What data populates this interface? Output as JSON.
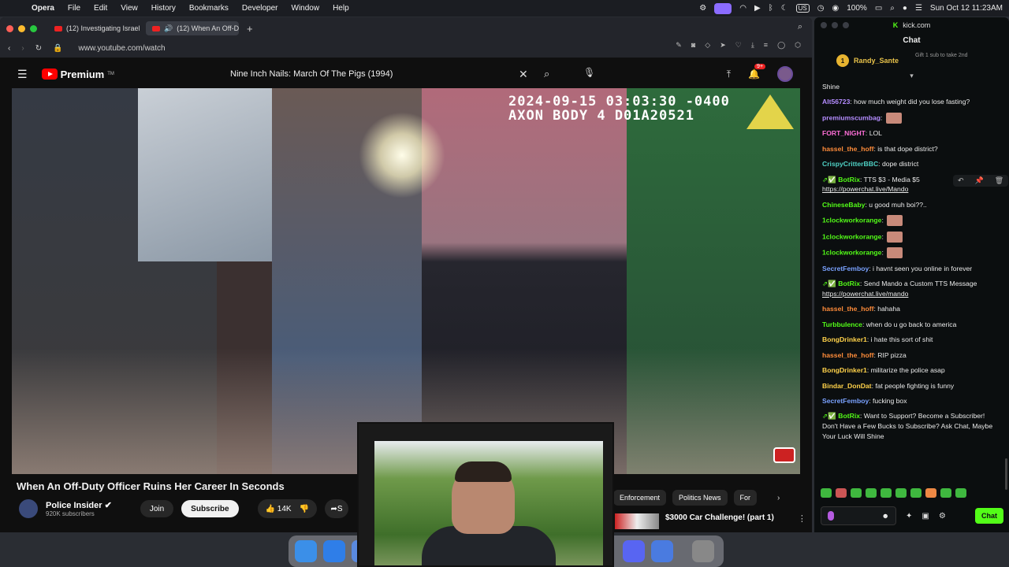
{
  "menubar": {
    "app": "Opera",
    "items": [
      "File",
      "Edit",
      "View",
      "History",
      "Bookmarks",
      "Developer",
      "Window",
      "Help"
    ],
    "battery": "100%",
    "keyboard": "US",
    "datetime": "Sun Oct 12  11:23AM"
  },
  "browser": {
    "tabs": [
      {
        "label": "(12) Investigating Israel"
      },
      {
        "label": "(12) When An Off-D"
      }
    ],
    "url": "www.youtube.com/watch"
  },
  "youtube": {
    "brand": "Premium",
    "brand_tm": "TM",
    "search_query": "Nine Inch Nails: March Of The Pigs (1994)",
    "notification_count": "9+",
    "video": {
      "timestamp_line1": "2024-09-15 03:03:30 -0400",
      "timestamp_line2": "AXON BODY 4 D01A20521"
    },
    "title": "When An Off-Duty Officer Ruins Her Career In Seconds",
    "channel": "Police Insider",
    "subscribers": "920K subscribers",
    "join_label": "Join",
    "subscribe_label": "Subscribe",
    "likes": "14K",
    "share_label": "S",
    "chips": [
      "Enforcement",
      "Politics News",
      "For"
    ],
    "reco_title": "$3000 Car Challenge! (part 1)"
  },
  "chat": {
    "site": "kick.com",
    "header": "Chat",
    "pinned_user": "Randy_Sante",
    "pinned_level": "1",
    "pinned_gift": "Gift 1 sub to take 2nd",
    "messages": [
      {
        "user": "",
        "text": "Shine",
        "color": "#eaeaea"
      },
      {
        "user": "Alt56723",
        "text": "how much weight did you lose fasting?",
        "color": "#b48cff"
      },
      {
        "user": "premiumscumbag",
        "text": "",
        "color": "#b48cff",
        "emote": true
      },
      {
        "user": "FORT_NIGHT",
        "text": "LOL",
        "color": "#ff6fd8"
      },
      {
        "user": "hassel_the_hoff",
        "text": "is that dope district?",
        "color": "#ff8c3a"
      },
      {
        "user": "CrispyCritterBBC",
        "text": "dope district",
        "color": "#4fd1c5"
      },
      {
        "user": "BotRix",
        "text": "TTS $3 - Media $5",
        "link": "https://powerchat.live/Mando",
        "color": "#53fc18",
        "bot": true
      },
      {
        "user": "ChineseBaby",
        "text": "u good muh boi??..",
        "color": "#53fc18"
      },
      {
        "user": "1clockworkorange",
        "text": "",
        "color": "#53fc18",
        "emote": true
      },
      {
        "user": "1clockworkorange",
        "text": "",
        "color": "#53fc18",
        "emote": true
      },
      {
        "user": "1clockworkorange",
        "text": "",
        "color": "#53fc18",
        "emote": true
      },
      {
        "user": "SecretFemboy",
        "text": "i havnt seen you online in forever",
        "color": "#7aa2ff"
      },
      {
        "user": "BotRix",
        "text": "Send Mando a Custom TTS Message",
        "link": "https://powerchat.live/mando",
        "color": "#53fc18",
        "bot": true
      },
      {
        "user": "hassel_the_hoff",
        "text": "hahaha",
        "color": "#ff8c3a"
      },
      {
        "user": "Turbbulence",
        "text": "when do u go back to america",
        "color": "#53fc18"
      },
      {
        "user": "BongDrinker1",
        "text": "i hate this sort of shit",
        "color": "#ffd24a"
      },
      {
        "user": "hassel_the_hoff",
        "text": "RIP pizza",
        "color": "#ff8c3a"
      },
      {
        "user": "BongDrinker1",
        "text": "militarize the police asap",
        "color": "#ffd24a"
      },
      {
        "user": "Bindar_DonDat",
        "text": "fat people fighting is funny",
        "color": "#ffd24a"
      },
      {
        "user": "SecretFemboy",
        "text": "fucking box",
        "color": "#7aa2ff"
      },
      {
        "user": "BotRix",
        "text": "Want to Support? Become a Subscriber! Don't Have a Few Bucks to Subscribe? Ask Chat, Maybe Your Luck Will Shine",
        "color": "#53fc18",
        "bot": true
      }
    ],
    "send_label": "Chat"
  }
}
